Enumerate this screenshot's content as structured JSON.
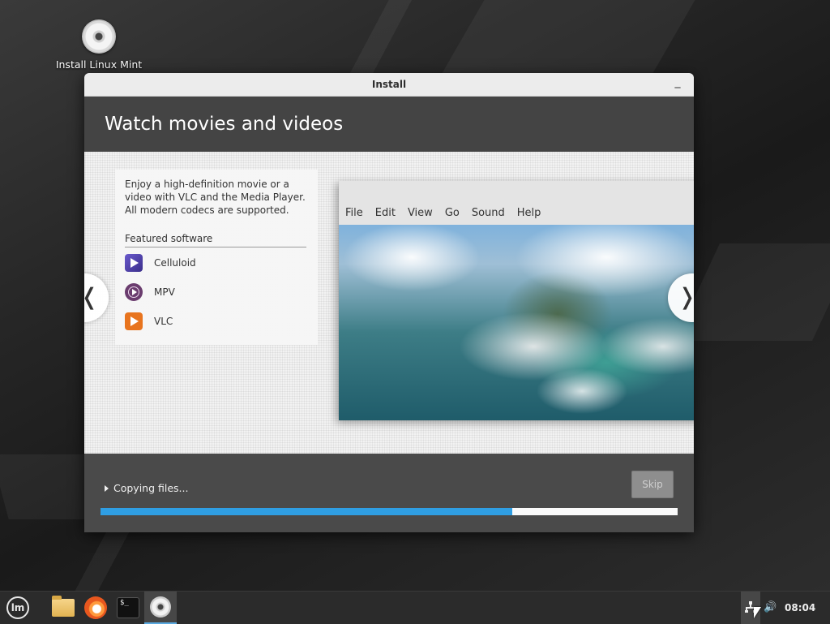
{
  "desktop": {
    "icon_label": "Install Linux Mint"
  },
  "window": {
    "title": "Install",
    "minimize_glyph": "_"
  },
  "slide": {
    "heading": "Watch movies and videos",
    "description": "Enjoy a high-definition movie or a video with VLC and the Media Player. All modern codecs are supported.",
    "featured_title": "Featured software",
    "apps": [
      {
        "label": "Celluloid",
        "icon": "celluloid-icon"
      },
      {
        "label": "MPV",
        "icon": "mpv-icon"
      },
      {
        "label": "VLC",
        "icon": "vlc-icon"
      }
    ],
    "player_menu": [
      "File",
      "Edit",
      "View",
      "Go",
      "Sound",
      "Help"
    ],
    "prev_glyph": "❬",
    "next_glyph": "❭"
  },
  "status": {
    "text": "Copying files...",
    "skip_label": "Skip",
    "progress": 0.713
  },
  "taskbar": {
    "menu_logo_text": "lm",
    "terminal_text": "$_",
    "volume_glyph": "🔊",
    "clock": "08:04"
  },
  "colors": {
    "accent": "#2f9ee3",
    "header_bg": "#444444",
    "taskbar_bg": "#2b2b2b"
  }
}
